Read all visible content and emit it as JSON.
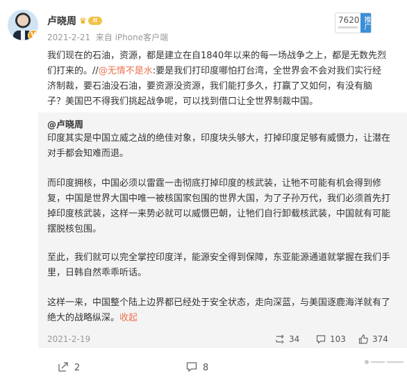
{
  "author": {
    "name": "卢晓周",
    "level": "II",
    "verified_mark": "V",
    "post_date": "2021-2-21",
    "source": "来自 iPhone客户端"
  },
  "promo": {
    "count": "7620",
    "tag": "推广"
  },
  "post": {
    "text_before": "我们现在的石油，资源，都是建立在自1840年以来的每一场战争之上，都是无数先烈们打来的。//",
    "mention": "@无情不是水",
    "text_after": ":要是我们打印度哪怕打台湾，全世界会不会对我们实行经济制裁，要石油没石油，要资源没资源，我们能打多久，打赢了又如何，有没有脑子？美国巴不得我们挑起战争呢，可以找到借口让全世界制裁中国。"
  },
  "repost": {
    "author": "@卢晓周",
    "paragraphs": [
      "印度其实是中国立威之战的绝佳对象，印度块头够大，打掉印度足够有威慑力，让潜在对手都会知难而退。",
      "而印度拥核，中国必须以雷霆一击彻底打掉印度的核武装，让牠不可能有机会得到修复，中国是世界大国中唯一被核国家包围的世界大国，为了子孙万代，我们必须首先打掉印度核武装，这样一来势必就可以威慑巴朝，让牠们自行卸载核武装，中国就有可能摆脱核包围。",
      "至此，我们就可以完全掌控印度洋，能源安全得到保障，东亚能源通道就掌握在我们手里，日韩自然乖乖听话。",
      "这样一来，中国整个陆上边界都已经处于安全状态，走向深蓝，与美国逐鹿海洋就有了绝大的战略纵深。"
    ],
    "collapse_label": "收起",
    "date": "2021-2-19",
    "reposts": "34",
    "comments": "103",
    "likes": "374"
  },
  "actions": {
    "reposts": "2",
    "comments": "8"
  },
  "icons": {
    "repost": "repost-icon",
    "comment": "comment-icon",
    "like": "thumbs-up-icon"
  }
}
